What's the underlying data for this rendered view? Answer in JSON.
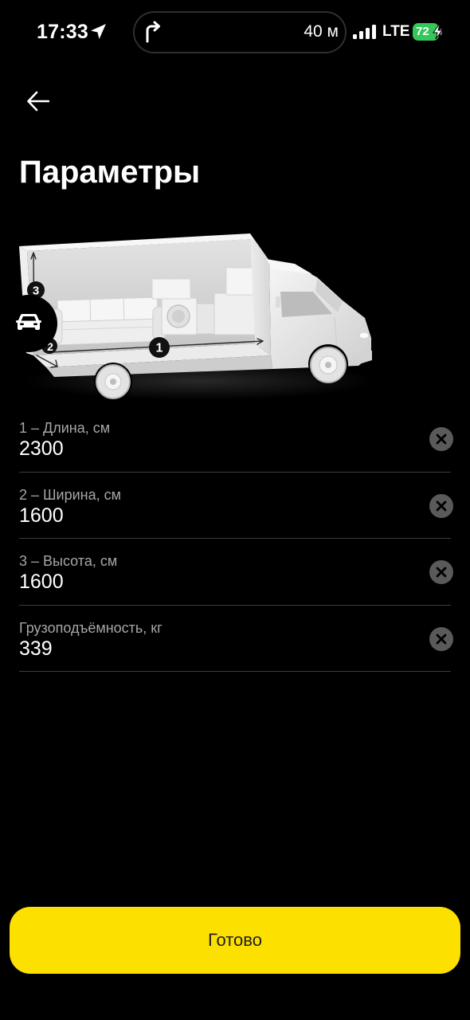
{
  "status_bar": {
    "time": "17:33",
    "navigation_distance": "40 м",
    "network": "LTE",
    "battery_percent": "72"
  },
  "header": {
    "title": "Параметры"
  },
  "illustration": {
    "markers": {
      "length": "1",
      "width": "2",
      "height": "3"
    }
  },
  "fields": [
    {
      "label": "1 – Длина, см",
      "value": "2300"
    },
    {
      "label": "2 – Ширина, см",
      "value": "1600"
    },
    {
      "label": "3 – Высота, см",
      "value": "1600"
    },
    {
      "label": "Грузоподъёмность, кг",
      "value": "339"
    }
  ],
  "done_button": {
    "label": "Готово"
  },
  "icons": {
    "location": "location-arrow-icon",
    "navigation_turn": "turn-right-icon",
    "signal": "signal-icon",
    "battery": "battery-icon",
    "charging": "charging-bolt-icon",
    "back": "back-arrow-icon",
    "vehicle": "car-icon",
    "clear": "clear-icon"
  },
  "colors": {
    "background": "#000000",
    "accent": "#FCE000",
    "accent_text": "#21201F",
    "battery_charging": "#34C759",
    "label": "#A6A6A6",
    "value": "#FFFFFF",
    "divider": "#3D3D3D",
    "clear_icon": "#5A5A5A"
  }
}
